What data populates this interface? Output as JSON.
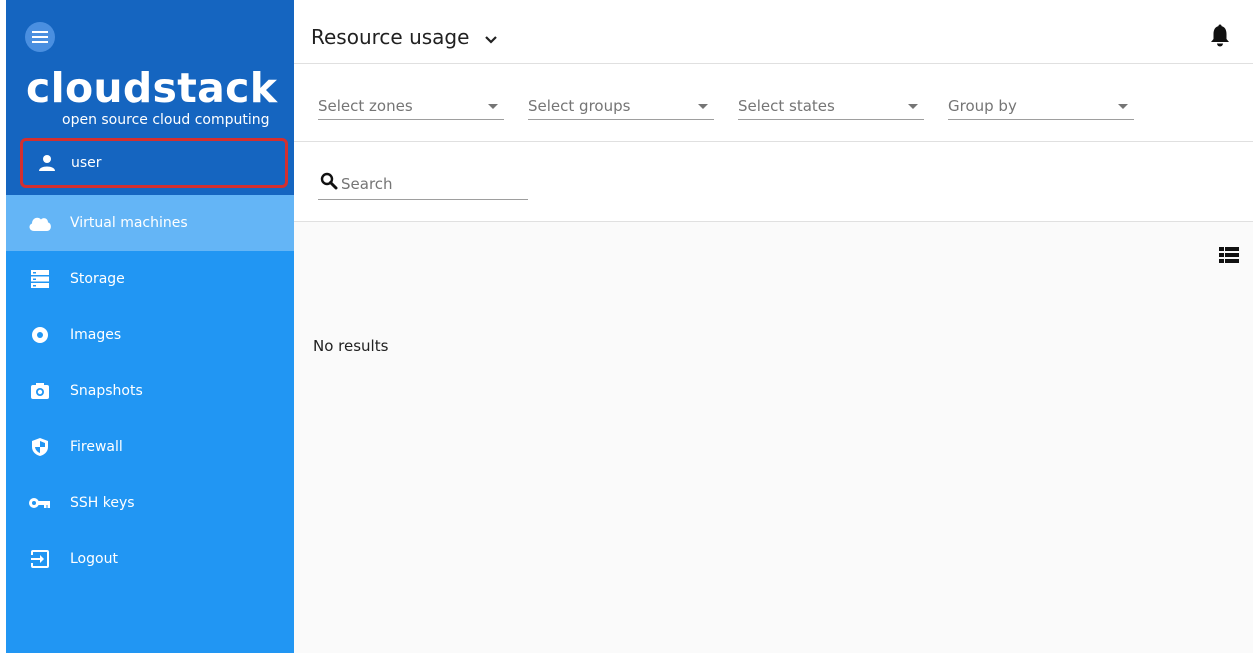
{
  "app": {
    "brand": "cloudstack",
    "tagline": "open source cloud computing"
  },
  "user": {
    "label": "user"
  },
  "nav": {
    "items": [
      {
        "label": "Virtual machines",
        "icon": "cloud-icon",
        "active": true
      },
      {
        "label": "Storage",
        "icon": "storage-icon",
        "active": false
      },
      {
        "label": "Images",
        "icon": "disc-icon",
        "active": false
      },
      {
        "label": "Snapshots",
        "icon": "camera-icon",
        "active": false
      },
      {
        "label": "Firewall",
        "icon": "shield-icon",
        "active": false
      },
      {
        "label": "SSH keys",
        "icon": "key-icon",
        "active": false
      },
      {
        "label": "Logout",
        "icon": "logout-icon",
        "active": false
      }
    ]
  },
  "header": {
    "title": "Resource usage"
  },
  "filters": {
    "zones": "Select zones",
    "groups": "Select groups",
    "states": "Select states",
    "group_by": "Group by"
  },
  "search": {
    "placeholder": "Search",
    "value": ""
  },
  "content": {
    "empty_message": "No results"
  },
  "colors": {
    "sidebar": "#2196f3",
    "sidebar_top": "#1565c0",
    "active_item": "#64b5f6",
    "highlight_border": "#d32f2f"
  }
}
